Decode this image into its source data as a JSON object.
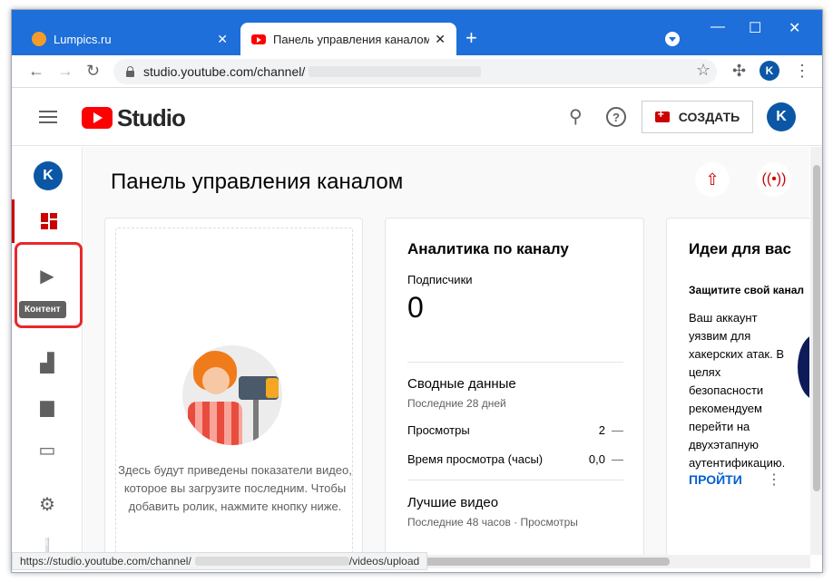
{
  "browser": {
    "tabs": [
      {
        "title": "Lumpics.ru",
        "active": false,
        "favicon": "lumpics-favicon"
      },
      {
        "title": "Панель управления каналом - YouTube Studio",
        "active": true,
        "favicon": "youtube-favicon"
      }
    ],
    "new_tab": "+",
    "url_prefix": "studio.youtube.com/channel/",
    "profile_initial": "K"
  },
  "header": {
    "logo_text": "Studio",
    "create_label": "СОЗДАТЬ",
    "avatar_initial": "K"
  },
  "sidebar": {
    "avatar_initial": "K",
    "items": [
      {
        "name": "dashboard",
        "icon": "dashboard-icon",
        "active": true
      },
      {
        "name": "content",
        "icon": "content-icon",
        "tooltip": "Контент"
      },
      {
        "name": "analytics",
        "icon": "analytics-icon"
      },
      {
        "name": "comments",
        "icon": "comments-icon"
      },
      {
        "name": "subtitles",
        "icon": "subtitles-icon"
      },
      {
        "name": "settings",
        "icon": "settings-icon"
      },
      {
        "name": "feedback",
        "icon": "feedback-icon"
      }
    ],
    "tooltip": "Контент"
  },
  "main": {
    "title": "Панель управления каналом",
    "empty_card_text": "Здесь будут приведены показатели видео, которое вы загрузите последним. Чтобы добавить ролик, нажмите кнопку ниже.",
    "analytics": {
      "title": "Аналитика по каналу",
      "subscribers_label": "Подписчики",
      "subscribers_value": "0",
      "summary_title": "Сводные данные",
      "summary_period": "Последние 28 дней",
      "rows": [
        {
          "label": "Просмотры",
          "value": "2",
          "delta": "—"
        },
        {
          "label": "Время просмотра (часы)",
          "value": "0,0",
          "delta": "—"
        }
      ],
      "top_title": "Лучшие видео",
      "top_period": "Последние 48 часов · Просмотры"
    },
    "ideas": {
      "title": "Идеи для вас",
      "subtitle": "Защитите свой канал",
      "body": "Ваш аккаунт уязвим для хакерских атак. В целях безопасности рекомендуем перейти на двухэтапную аутентификацию.",
      "go_label": "ПРОЙТИ"
    }
  },
  "status_bar": {
    "url_start": "https://studio.youtube.com/channel/",
    "url_end": "/videos/upload"
  },
  "colors": {
    "brand_red": "#ff0000",
    "accent_blue": "#065fd4",
    "tabstrip": "#1e6fd9",
    "highlight": "#e8282b"
  }
}
